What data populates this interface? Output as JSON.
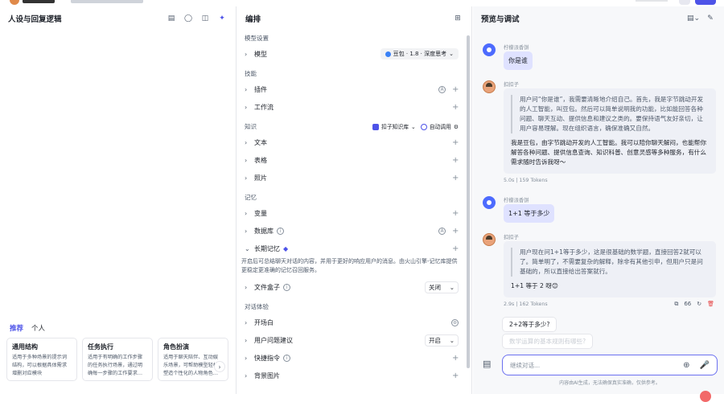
{
  "left": {
    "title": "人设与回复逻辑",
    "template_tabs": [
      "推荐",
      "个人"
    ],
    "templates": [
      {
        "title": "通用结构",
        "desc": "适用于多种场景的提示词结构，可以根据具体需求增删对应模块"
      },
      {
        "title": "任务执行",
        "desc": "适用于有明确的工作步骤的任务执行场景，通过明确每一步骤的工作要求…"
      },
      {
        "title": "角色扮演",
        "desc": "适用于聊天陪伴、互动娱乐场景，可帮助模型轻松塑造个性化的人物角色…"
      }
    ]
  },
  "mid": {
    "title": "编排",
    "model_section": "模型设置",
    "model_row": "模型",
    "model_value": "豆包 · 1.8 · 深度思考",
    "skills_section": "技能",
    "plugin": "插件",
    "workflow": "工作流",
    "knowledge_section": "知识",
    "kb_label": "扣子知识库",
    "auto_call": "自动调用",
    "text": "文本",
    "table": "表格",
    "photo": "照片",
    "memory_section": "记忆",
    "variables": "变量",
    "database": "数据库",
    "long_memory": "长期记忆",
    "long_memory_note": "开启后可总结聊天对话的内容，并用于更好的响应用户的消息。由火山引擎-记忆库提供更稳定更准确的记忆召回服务。",
    "file_box": "文件盒子",
    "file_box_value": "关闭",
    "dialog_section": "对话体验",
    "opener": "开场白",
    "user_question": "用户问题建议",
    "user_question_value": "开启",
    "shortcut": "快捷指令",
    "bg_image": "背景图片"
  },
  "right": {
    "title": "预览与调试",
    "user_name": "柠檬派香饼",
    "bot_name": "扣扣子",
    "msg1_user": "你是谁",
    "msg1_quote": "用户问“你是谁”，我需要清晰地介绍自己。首先，我是字节跳动开发的人工智能，叫豆包。然后可以简单说明我的功能，比如能回答各种问题、聊天互动、提供信息和建议之类的。要保持语气友好亲切，让用户容易理解。现在组织语言，确保准确又自然。",
    "msg1_answer": "我是豆包，由字节跳动开发的人工智能。我可以陪你聊天解闷，也能帮你解答各种问题、提供信息查询、知识科普、创意灵感等多种服务，有什么需求随时告诉我呀～",
    "msg1_meta": "5.0s  |  159 Tokens",
    "msg2_user": "1+1 等于多少",
    "msg2_quote": "用户现在问1+1等于多少，这是很基础的数学题，直接回答2就可以了。简单明了，不需要复杂的解释，除非有其他引申，但用户只是问基础的，所以直接给出答案就行。",
    "msg2_answer": "1+1 等于 2 呀😊",
    "msg2_meta": "2.9s  |  162 Tokens",
    "suggestion_1": "2+2等于多少?",
    "suggestion_2": "数学运算的基本规则有哪些?",
    "input_placeholder": "继续对话...",
    "disclaimer": "内容由AI生成，无法确保真实准确，仅供参考。"
  }
}
